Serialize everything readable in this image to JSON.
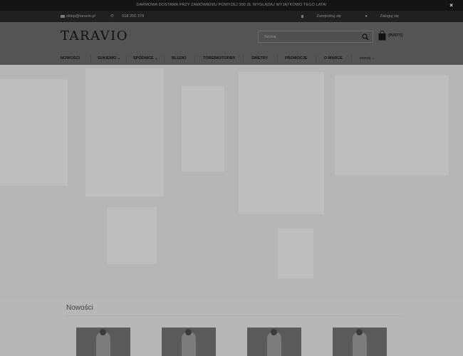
{
  "promo": {
    "text": "DARMOWA DOSTAWA PRZY ZAMÓWIENIU POWYŻEJ 300 ZŁ    WYGLĄDAJ WYJĄTKOWO TEGO LATA!",
    "close": "×"
  },
  "topbar": {
    "email": "sklep@taravio.pl",
    "phone": "518 206 379",
    "register": "Zarejestruj się",
    "login": "Zaloguj się"
  },
  "header": {
    "logo": "TARAVIO",
    "search_placeholder": "Szukaj",
    "cart_label": "(PUSTY)"
  },
  "nav": {
    "items": [
      {
        "label": "NOWOŚCI"
      },
      {
        "label": "SUKIENKI",
        "caret": "⌄"
      },
      {
        "label": "SPÓDNICE",
        "caret": "⌄"
      },
      {
        "label": "BLUZKI"
      },
      {
        "label": "TOREBKI/TORBY"
      },
      {
        "label": "SWETRY"
      },
      {
        "label": "PROMOCJE"
      },
      {
        "label": "O MARCE"
      },
      {
        "label": "więcej",
        "caret": "⌄"
      }
    ]
  },
  "section": {
    "title": "Nowości"
  },
  "colors": {
    "overlay": "#b7b7b7",
    "header": "#545454",
    "topbar": "#202020",
    "promo": "#141414"
  }
}
